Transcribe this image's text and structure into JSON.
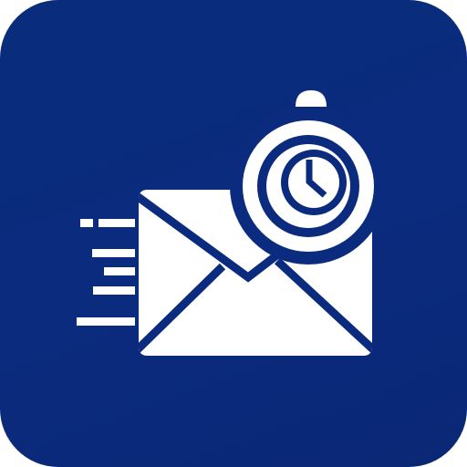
{
  "app_icon": {
    "name": "email-timer-app-icon",
    "background_color": "#0b2b7e",
    "glyph_color": "#ffffff",
    "icons": [
      "speed-lines-icon",
      "envelope-icon",
      "stopwatch-icon"
    ]
  }
}
